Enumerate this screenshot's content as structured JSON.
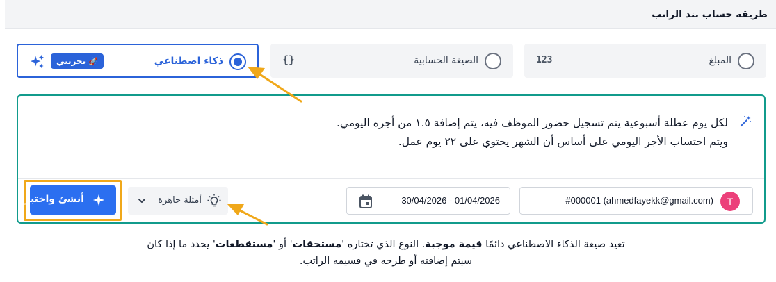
{
  "header": {
    "title": "طريقة حساب بند الراتب"
  },
  "options": [
    {
      "label": "ذكاء اصطناعي",
      "selected": true,
      "badge": "تجريبي",
      "icon": "sparkles-icon"
    },
    {
      "label": "الصيغة الحسابية",
      "selected": false,
      "icon_text": "{}"
    },
    {
      "label": "المبلغ",
      "selected": false,
      "icon_text": "123"
    }
  ],
  "prompt": {
    "line1": "لكل يوم عطلة أسبوعية يتم تسجيل حضور الموظف فيه، يتم إضافة ١.٥ من أجره اليومي.",
    "line2": "ويتم احتساب الأجر اليومي على أساس أن الشهر يحتوي على ٢٢ يوم عمل."
  },
  "employee": {
    "avatar_letter": "T",
    "value": "#000001 (ahmedfayekk@gmail.com)"
  },
  "date_range": {
    "value": "30/04/2026 - 01/04/2026"
  },
  "examples_button": {
    "label": "أمثلة جاهزة"
  },
  "generate_button": {
    "label": "أنشئ واختبر"
  },
  "note": {
    "part1": "تعيد صيغة الذكاء الاصطناعي دائمًا ",
    "bold1": "قيمة موجبة",
    "part2": ". النوع الذي تختاره '",
    "bold2": "مستحقات",
    "part3": "' أو '",
    "bold3": "مستقطعات",
    "part4": "' يحدد ما إذا كان",
    "line2": "سيتم إضافته أو طرحه في قسيمه الراتب."
  },
  "colors": {
    "primary": "#2b63d9",
    "teal_border": "#119b8c",
    "annotation_orange": "#f0a81a",
    "avatar": "#ec407a"
  }
}
